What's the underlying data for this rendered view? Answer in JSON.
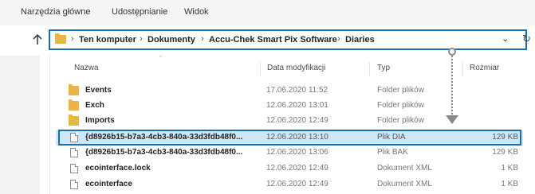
{
  "ribbon": {
    "tabs": [
      "Narzędzia główne",
      "Udostępnianie",
      "Widok"
    ]
  },
  "address": {
    "segments": [
      "Ten komputer",
      "Dokumenty",
      "Accu-Chek Smart Pix Software",
      "Diaries"
    ],
    "separator": "›",
    "dropdown_icon": "chevron-down-icon",
    "refresh_icon": "refresh-icon"
  },
  "columns": {
    "name": "Nazwa",
    "date": "Data modyfikacji",
    "type": "Typ",
    "size": "Rozmiar"
  },
  "files": [
    {
      "name": "Events",
      "date": "17.06.2020 11:52",
      "type": "Folder plików",
      "size": "",
      "icon": "folder-icon"
    },
    {
      "name": "Exch",
      "date": "12.06.2020 13:01",
      "type": "Folder plików",
      "size": "",
      "icon": "folder-icon"
    },
    {
      "name": "Imports",
      "date": "12.06.2020 12:49",
      "type": "Folder plików",
      "size": "",
      "icon": "folder-icon"
    },
    {
      "name": "{d8926b15-b7a3-4cb3-840a-33d3fdb48f0...",
      "date": "12.06.2020 13:10",
      "type": "Plik DIA",
      "size": "129 KB",
      "icon": "file-icon",
      "selected": true
    },
    {
      "name": "{d8926b15-b7a3-4cb3-840a-33d3fdb48f0...",
      "date": "12.06.2020 13:06",
      "type": "Plik BAK",
      "size": "129 KB",
      "icon": "file-icon"
    },
    {
      "name": "ecointerface.lock",
      "date": "12.06.2020 12:49",
      "type": "Dokument XML",
      "size": "1 KB",
      "icon": "file-icon"
    },
    {
      "name": "ecointerface",
      "date": "12.06.2020 12:49",
      "type": "Dokument XML",
      "size": "1 KB",
      "icon": "file-icon"
    }
  ],
  "colors": {
    "highlight_border": "#1b6fb0",
    "selection": "#cde8fb",
    "folder": "#e8b548",
    "annotation_arrow": "#8a8a8a"
  }
}
